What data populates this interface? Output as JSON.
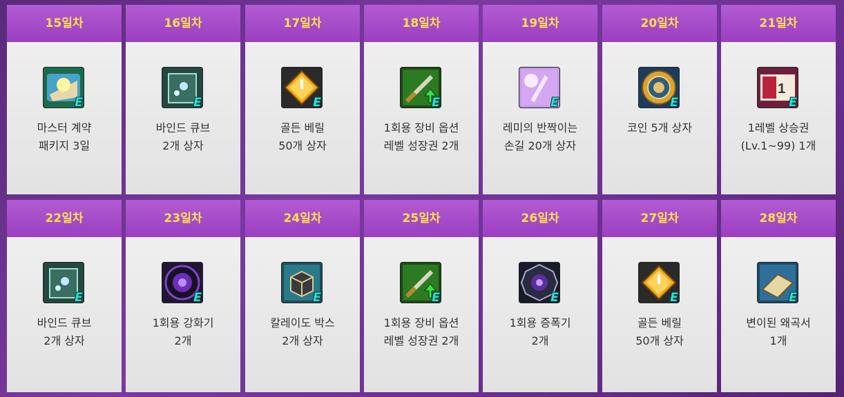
{
  "title_suffix": "일차",
  "row1": [
    {
      "day": "15일차",
      "line1": "마스터 계약",
      "line2": "패키지 3일",
      "icon": "master-contract-icon",
      "bg": "#1b6c4c"
    },
    {
      "day": "16일차",
      "line1": "바인드 큐브",
      "line2": "2개 상자",
      "icon": "bind-cube-icon",
      "bg": "#24483f"
    },
    {
      "day": "17일차",
      "line1": "골든 베릴",
      "line2": "50개 상자",
      "icon": "golden-beryl-icon",
      "bg": "#2a2a2a"
    },
    {
      "day": "18일차",
      "line1": "1회용 장비 옵션",
      "line2": "레벨 성장권 2개",
      "icon": "option-level-ticket-icon",
      "bg": "#1a4a14"
    },
    {
      "day": "19일차",
      "line1": "레미의 반짝이는",
      "line2": "손길 20개 상자",
      "icon": "remy-touch-icon",
      "bg": "#c49ae6"
    },
    {
      "day": "20일차",
      "line1": "코인 5개 상자",
      "line2": "",
      "icon": "coin-icon",
      "bg": "#1d3d5e"
    },
    {
      "day": "21일차",
      "line1": "1레벨 상승권",
      "line2": "(Lv.1~99) 1개",
      "icon": "level-up-ticket-icon",
      "bg": "#6a1f3a"
    }
  ],
  "row2": [
    {
      "day": "22일차",
      "line1": "바인드 큐브",
      "line2": "2개 상자",
      "icon": "bind-cube-icon",
      "bg": "#24483f"
    },
    {
      "day": "23일차",
      "line1": "1회용 강화기",
      "line2": "2개",
      "icon": "enhancer-icon",
      "bg": "#201634"
    },
    {
      "day": "24일차",
      "line1": "칼레이도 박스",
      "line2": "2개 상자",
      "icon": "kaleido-box-icon",
      "bg": "#1e4e5a"
    },
    {
      "day": "25일차",
      "line1": "1회용 장비 옵션",
      "line2": "레벨 성장권 2개",
      "icon": "option-level-ticket-icon",
      "bg": "#1a4a14"
    },
    {
      "day": "26일차",
      "line1": "1회용 증폭기",
      "line2": "2개",
      "icon": "amplifier-icon",
      "bg": "#1a1a2a"
    },
    {
      "day": "27일차",
      "line1": "골든 베릴",
      "line2": "50개 상자",
      "icon": "golden-beryl-icon",
      "bg": "#2a2a2a"
    },
    {
      "day": "28일차",
      "line1": "변이된 왜곡서",
      "line2": "1개",
      "icon": "mutated-scroll-icon",
      "bg": "#1d4a6a"
    }
  ],
  "badge": "E"
}
